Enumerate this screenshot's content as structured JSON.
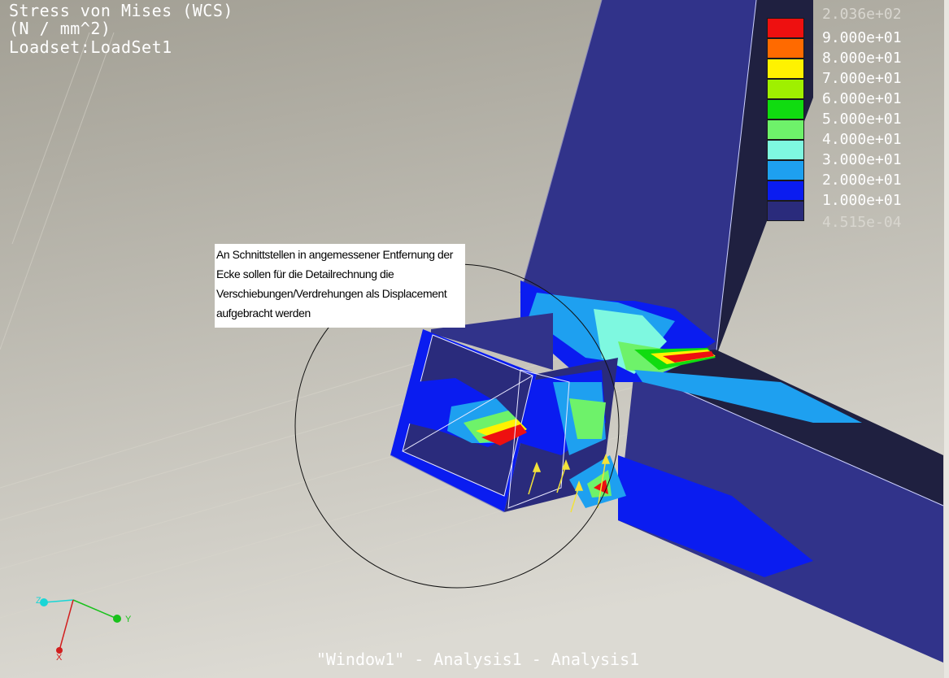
{
  "header": {
    "title": "Stress von Mises (WCS)",
    "units": "(N / mm^2)",
    "loadset": "Loadset:LoadSet1"
  },
  "legend": {
    "max_label": "2.036e+02",
    "min_label": "4.515e-04",
    "bands": [
      {
        "color": "#ee1010",
        "label": "9.000e+01"
      },
      {
        "color": "#ff6a00",
        "label": "8.000e+01"
      },
      {
        "color": "#fff200",
        "label": "7.000e+01"
      },
      {
        "color": "#9ff000",
        "label": "6.000e+01"
      },
      {
        "color": "#10dc10",
        "label": "5.000e+01"
      },
      {
        "color": "#6ef26a",
        "label": "4.000e+01"
      },
      {
        "color": "#7ef8e0",
        "label": "3.000e+01"
      },
      {
        "color": "#1ea0f0",
        "label": "2.000e+01"
      },
      {
        "color": "#0a1cf0",
        "label": "1.000e+01"
      },
      {
        "color": "#2a2b7c",
        "label": ""
      }
    ]
  },
  "annotation": {
    "lines": [
      "An Schnittstellen in angemessener Entfernung der",
      "Ecke sollen für die Detailrechnung die",
      "Verschiebungen/Verdrehungen als Displacement",
      "aufgebracht werden"
    ]
  },
  "triad": {
    "z": "Z",
    "y": "Y",
    "x": "X"
  },
  "footer": "\"Window1\" - Analysis1 - Analysis1",
  "colors": {
    "background_top": "#a6a398",
    "background_bottom": "#d8d6cf",
    "beam_dark": "#2a2b7c",
    "beam_face": "#31338a",
    "beam_shadow": "#1f2040"
  }
}
